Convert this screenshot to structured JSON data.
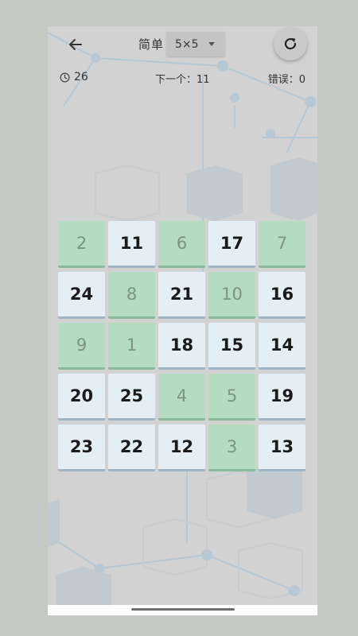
{
  "header": {
    "back_icon": "arrow-left-icon",
    "difficulty": "简单",
    "size": "5×5",
    "dropdown_icon": "caret-down-icon",
    "refresh_icon": "refresh-icon"
  },
  "status": {
    "timer_icon": "clock-icon",
    "timer": "26",
    "next_label": "下一个：",
    "next_value": "11",
    "errors_label": "错误：",
    "errors_value": "0"
  },
  "board": {
    "tiles": [
      {
        "n": "2",
        "done": true
      },
      {
        "n": "11",
        "done": false
      },
      {
        "n": "6",
        "done": true
      },
      {
        "n": "17",
        "done": false
      },
      {
        "n": "7",
        "done": true
      },
      {
        "n": "24",
        "done": false
      },
      {
        "n": "8",
        "done": true
      },
      {
        "n": "21",
        "done": false
      },
      {
        "n": "10",
        "done": true
      },
      {
        "n": "16",
        "done": false
      },
      {
        "n": "9",
        "done": true
      },
      {
        "n": "1",
        "done": true
      },
      {
        "n": "18",
        "done": false
      },
      {
        "n": "15",
        "done": false
      },
      {
        "n": "14",
        "done": false
      },
      {
        "n": "20",
        "done": false
      },
      {
        "n": "25",
        "done": false
      },
      {
        "n": "4",
        "done": true
      },
      {
        "n": "5",
        "done": true
      },
      {
        "n": "19",
        "done": false
      },
      {
        "n": "23",
        "done": false
      },
      {
        "n": "22",
        "done": false
      },
      {
        "n": "12",
        "done": false
      },
      {
        "n": "3",
        "done": true
      },
      {
        "n": "13",
        "done": false
      }
    ]
  },
  "colors": {
    "tile_pending": "#e3eef5",
    "tile_done": "#b3dcc1",
    "background": "#d2d2d2"
  }
}
